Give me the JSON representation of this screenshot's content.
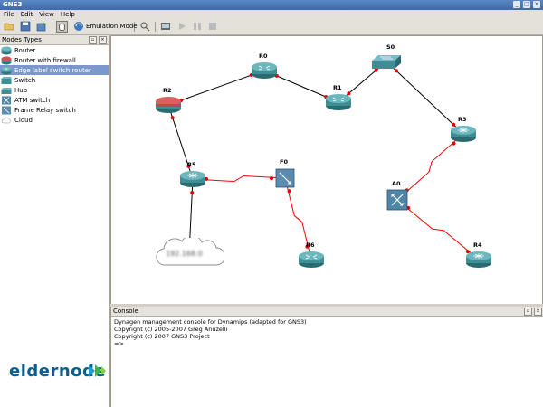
{
  "window": {
    "title": "GNS3"
  },
  "menu": {
    "items": [
      "File",
      "Edit",
      "View",
      "Help"
    ]
  },
  "toolbar": {
    "emulation_mode_label": "Emulation Mode"
  },
  "nodes_panel": {
    "title": "Nodes Types",
    "items": [
      {
        "label": "Router",
        "icon": "router-icon"
      },
      {
        "label": "Router with firewall",
        "icon": "firewall-router-icon"
      },
      {
        "label": "Edge label switch router",
        "icon": "edge-switch-router-icon",
        "selected": true
      },
      {
        "label": "Switch",
        "icon": "switch-icon"
      },
      {
        "label": "Hub",
        "icon": "hub-icon"
      },
      {
        "label": "ATM switch",
        "icon": "atm-switch-icon"
      },
      {
        "label": "Frame Relay switch",
        "icon": "frame-relay-switch-icon"
      },
      {
        "label": "Cloud",
        "icon": "cloud-icon"
      }
    ]
  },
  "topology": {
    "nodes": [
      {
        "id": "R0",
        "label": "R0",
        "type": "router"
      },
      {
        "id": "R1",
        "label": "R1",
        "type": "router"
      },
      {
        "id": "S0",
        "label": "S0",
        "type": "switch"
      },
      {
        "id": "R2",
        "label": "R2",
        "type": "firewall-router"
      },
      {
        "id": "R3",
        "label": "R3",
        "type": "edge-router"
      },
      {
        "id": "R5",
        "label": "R5",
        "type": "edge-router"
      },
      {
        "id": "F0",
        "label": "F0",
        "type": "frame-relay"
      },
      {
        "id": "A0",
        "label": "A0",
        "type": "atm"
      },
      {
        "id": "R6",
        "label": "R6",
        "type": "router"
      },
      {
        "id": "R4",
        "label": "R4",
        "type": "edge-router"
      },
      {
        "id": "C0",
        "label": "192.168.0",
        "type": "cloud"
      }
    ],
    "links": [
      {
        "from": "R2",
        "to": "R0",
        "style": "ethernet"
      },
      {
        "from": "R0",
        "to": "R1",
        "style": "ethernet"
      },
      {
        "from": "R1",
        "to": "S0",
        "style": "ethernet"
      },
      {
        "from": "S0",
        "to": "R3",
        "style": "ethernet"
      },
      {
        "from": "R2",
        "to": "R5",
        "style": "ethernet"
      },
      {
        "from": "R5",
        "to": "C0",
        "style": "ethernet"
      },
      {
        "from": "R5",
        "to": "F0",
        "style": "serial"
      },
      {
        "from": "F0",
        "to": "R6",
        "style": "serial"
      },
      {
        "from": "R3",
        "to": "A0",
        "style": "serial"
      },
      {
        "from": "A0",
        "to": "R4",
        "style": "serial"
      }
    ]
  },
  "console": {
    "title": "Console",
    "lines": [
      "Dynagen management console for Dynamips (adapted for GNS3)",
      "Copyright (c) 2005-2007 Greg Anuzelli",
      "Copyright (c) 2007 GNS3 Project",
      "",
      "=>"
    ]
  },
  "watermark": {
    "text": "eldernode"
  },
  "colors": {
    "ethernet_link": "#000000",
    "serial_link": "#ff0000",
    "selection": "#7b97cc",
    "router_teal": "#3e8e94"
  }
}
